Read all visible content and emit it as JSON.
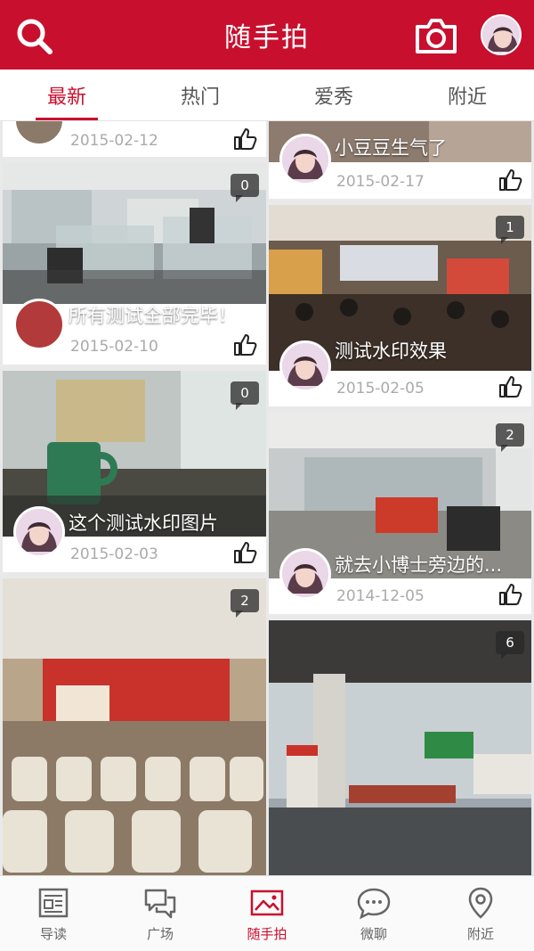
{
  "header": {
    "title": "随手拍",
    "accent": "#c8102e"
  },
  "tabs": [
    {
      "label": "最新",
      "active": true
    },
    {
      "label": "热门",
      "active": false
    },
    {
      "label": "爱秀",
      "active": false
    },
    {
      "label": "附近",
      "active": false
    }
  ],
  "posts": {
    "left_top": {
      "date": "2015-02-12"
    },
    "left_1": {
      "caption": "所有测试全部完毕！",
      "date": "2015-02-10",
      "count": "0"
    },
    "left_2": {
      "caption": "这个测试水印图片",
      "date": "2015-02-03",
      "count": "0"
    },
    "left_3": {
      "count": "2"
    },
    "right_top": {
      "caption": "小豆豆生气了",
      "date": "2015-02-17"
    },
    "right_1": {
      "caption": "测试水印效果",
      "date": "2015-02-05",
      "count": "1"
    },
    "right_2": {
      "caption": "就去小博士旁边的...",
      "date": "2014-12-05",
      "count": "2"
    },
    "right_3": {
      "count": "6"
    }
  },
  "bottom_nav": [
    {
      "label": "导读",
      "icon": "newspaper-icon",
      "active": false
    },
    {
      "label": "广场",
      "icon": "chat-bubbles-icon",
      "active": false
    },
    {
      "label": "随手拍",
      "icon": "photo-icon",
      "active": true
    },
    {
      "label": "微聊",
      "icon": "message-icon",
      "active": false
    },
    {
      "label": "附近",
      "icon": "location-pin-icon",
      "active": false
    }
  ]
}
